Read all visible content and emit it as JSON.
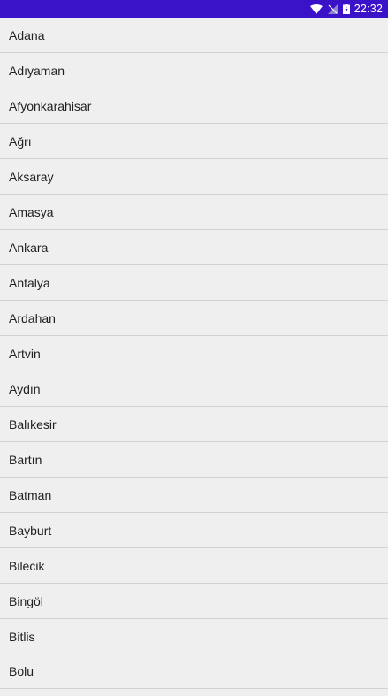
{
  "status_bar": {
    "time": "22:32",
    "icons": [
      "wifi-icon",
      "no-signal-icon",
      "battery-icon"
    ],
    "background": "#3a12c8"
  },
  "cities": [
    "Adana",
    "Adıyaman",
    "Afyonkarahisar",
    "Ağrı",
    "Aksaray",
    "Amasya",
    "Ankara",
    "Antalya",
    "Ardahan",
    "Artvin",
    "Aydın",
    "Balıkesir",
    "Bartın",
    "Batman",
    "Bayburt",
    "Bilecik",
    "Bingöl",
    "Bitlis",
    "Bolu"
  ]
}
